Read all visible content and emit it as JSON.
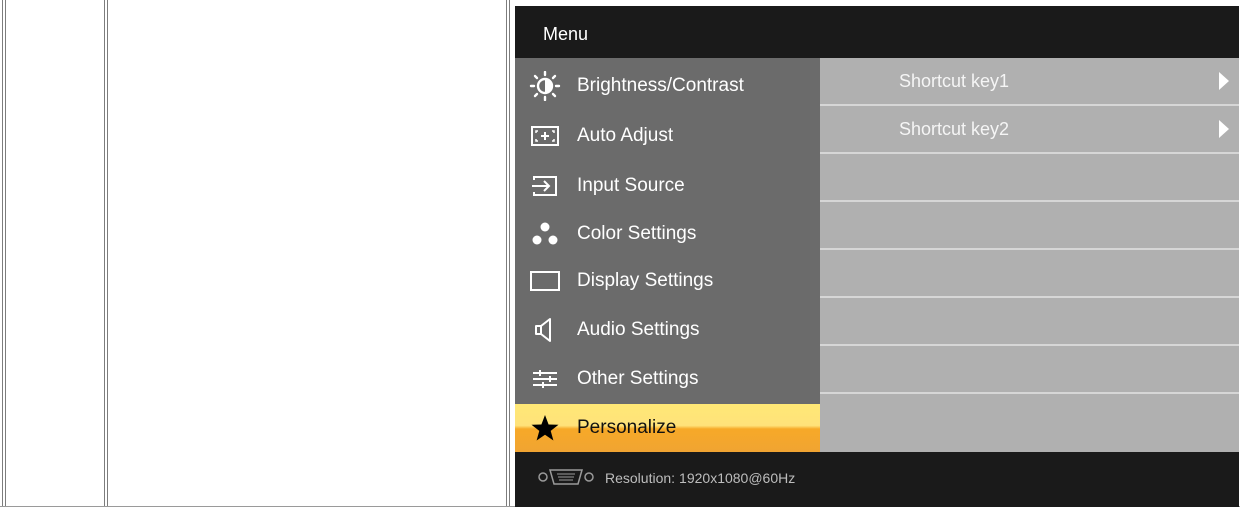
{
  "osd": {
    "title": "Menu",
    "menu_items": [
      {
        "label": "Brightness/Contrast",
        "icon": "brightness-icon"
      },
      {
        "label": "Auto Adjust",
        "icon": "auto-adjust-icon"
      },
      {
        "label": "Input Source",
        "icon": "input-source-icon"
      },
      {
        "label": "Color Settings",
        "icon": "color-settings-icon"
      },
      {
        "label": "Display Settings",
        "icon": "display-settings-icon"
      },
      {
        "label": "Audio Settings",
        "icon": "audio-settings-icon"
      },
      {
        "label": "Other Settings",
        "icon": "other-settings-icon"
      },
      {
        "label": "Personalize",
        "icon": "star-icon",
        "selected": true
      }
    ],
    "submenu": [
      {
        "label": "Shortcut key1",
        "has_arrow": true
      },
      {
        "label": "Shortcut key2",
        "has_arrow": true
      },
      {
        "label": "",
        "has_arrow": false
      },
      {
        "label": "",
        "has_arrow": false
      },
      {
        "label": "",
        "has_arrow": false
      },
      {
        "label": "",
        "has_arrow": false
      },
      {
        "label": "",
        "has_arrow": false
      },
      {
        "label": "",
        "has_arrow": false
      }
    ],
    "footer": {
      "resolution_label": "Resolution:",
      "resolution_value": "1920x1080@60Hz",
      "connector_icon": "vga-connector-icon"
    },
    "colors": {
      "menu_bg": "#6b6b6b",
      "submenu_bg": "#b0b0b0",
      "header_bg": "#1a1a1a",
      "highlight_top": "#ffe876",
      "highlight_bottom": "#f0a432"
    }
  }
}
